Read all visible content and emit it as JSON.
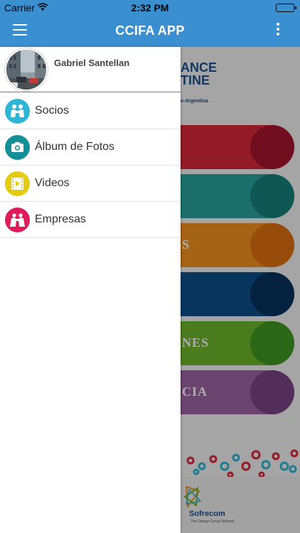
{
  "status_bar": {
    "carrier": "Carrier",
    "time": "2:32 PM"
  },
  "navbar": {
    "title": "CCIFA APP"
  },
  "background": {
    "brand_lines": [
      "ANCE",
      "TINE"
    ],
    "brand_sub": "e-Argentina",
    "pill_labels": [
      "",
      "",
      "S",
      "",
      "NES",
      "CIA"
    ],
    "pill_colors": [
      "#d7283a",
      "#2aa39c",
      "#f39221",
      "#0d4f8b",
      "#6db52b",
      "#9c64a4"
    ],
    "knob_colors": [
      "#a6142d",
      "#16807b",
      "#e07012",
      "#07335e",
      "#3f9a24",
      "#7b4485"
    ],
    "sponsor": {
      "name": "Sofrecom",
      "tagline": "The Orange Group Network"
    }
  },
  "drawer": {
    "user_name": "Gabriel Santellan",
    "items": [
      {
        "label": "Socios",
        "icon": "handshake-icon",
        "color": "#2fb6d6"
      },
      {
        "label": "Álbum de Fotos",
        "icon": "camera-icon",
        "color": "#138f97"
      },
      {
        "label": "Videos",
        "icon": "film-icon",
        "color": "#e3cb10"
      },
      {
        "label": "Empresas",
        "icon": "building-icon",
        "color": "#df1c5b"
      }
    ]
  }
}
